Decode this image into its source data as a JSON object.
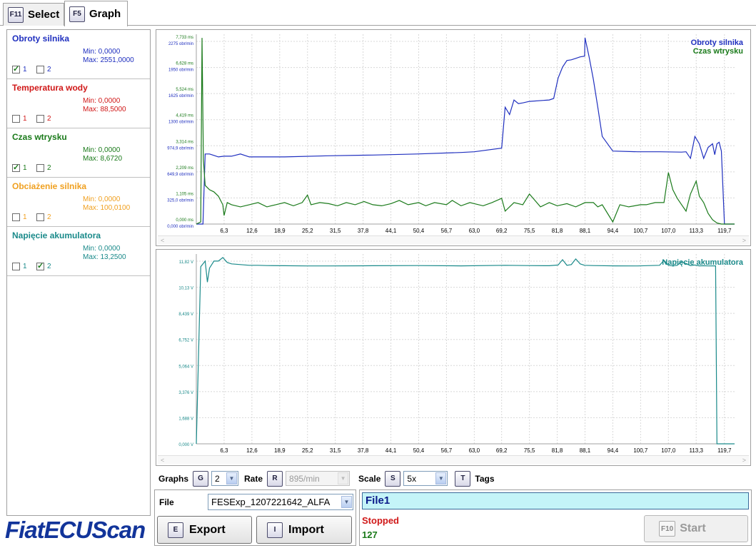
{
  "tabs": [
    {
      "key": "F11",
      "label": "Select"
    },
    {
      "key": "F5",
      "label": "Graph"
    }
  ],
  "signals": [
    {
      "name": "Obroty silnika",
      "min": "Min: 0,0000",
      "max": "Max: 2551,0000",
      "color": "#1f2fbf",
      "chk1": "1",
      "chk2": "2",
      "chk1_on": true,
      "chk2_on": false
    },
    {
      "name": "Temperatura wody",
      "min": "Min: 0,0000",
      "max": "Max: 88,5000",
      "color": "#d01818",
      "chk1": "1",
      "chk2": "2",
      "chk1_on": false,
      "chk2_on": false
    },
    {
      "name": "Czas wtrysku",
      "min": "Min: 0,0000",
      "max": "Max: 8,6720",
      "color": "#1a7a1a",
      "chk1": "1",
      "chk2": "2",
      "chk1_on": true,
      "chk2_on": false
    },
    {
      "name": "Obciażenie silnika",
      "min": "Min: 0,0000",
      "max": "Max: 100,0100",
      "color": "#f0a020",
      "chk1": "1",
      "chk2": "2",
      "chk1_on": false,
      "chk2_on": false
    },
    {
      "name": "Napięcie akumulatora",
      "min": "Min: 0,0000",
      "max": "Max: 13,2500",
      "color": "#1a8a8a",
      "chk1": "1",
      "chk2": "2",
      "chk1_on": false,
      "chk2_on": true
    }
  ],
  "logo": "FiatECUScan",
  "x_ticks": [
    "6,3",
    "12,6",
    "18,9",
    "25,2",
    "31,5",
    "37,8",
    "44,1",
    "50,4",
    "56,7",
    "63,0",
    "69,2",
    "75,5",
    "81,8",
    "88,1",
    "94,4",
    "100,7",
    "107,0",
    "113,3",
    "119,7"
  ],
  "graph1": {
    "legend": [
      "Obroty silnika",
      "Czas wtrysku"
    ],
    "legend_colors": [
      "#1f2fbf",
      "#1a7a1a"
    ],
    "y_labels_green": [
      "0,000 ms",
      "1,105 ms",
      "2,209 ms",
      "3,314 ms",
      "4,419 ms",
      "5,524 ms",
      "6,628 ms",
      "7,733 ms"
    ],
    "y_labels_blue": [
      "0,000 obr/min",
      "325,0 obr/min",
      "649,9 obr/min",
      "974,9 obr/min",
      "1300 obr/min",
      "1625 obr/min",
      "1950 obr/min",
      "2275 obr/min"
    ]
  },
  "graph2": {
    "legend": [
      "Napięcie akumulatora"
    ],
    "legend_colors": [
      "#1a8a8a"
    ],
    "y_labels": [
      "0,000 V",
      "1,688 V",
      "3,376 V",
      "5,064 V",
      "6,752 V",
      "8,439 V",
      "10,13 V",
      "11,82 V"
    ]
  },
  "chart_data": [
    {
      "type": "line",
      "title": "",
      "xlabel": "",
      "x_tick_labels": [
        "6,3",
        "12,6",
        "18,9",
        "25,2",
        "31,5",
        "37,8",
        "44,1",
        "50,4",
        "56,7",
        "63,0",
        "69,2",
        "75,5",
        "81,8",
        "88,1",
        "94,4",
        "100,7",
        "107,0",
        "113,3",
        "119,7"
      ],
      "xlim": [
        0,
        122
      ],
      "grid": true,
      "legend_position": "top-right",
      "series": [
        {
          "name": "Obroty silnika",
          "color": "#1f2fbf",
          "unit": "obr/min",
          "x": [
            0,
            1.5,
            2.0,
            3,
            4,
            5,
            6.3,
            8,
            10,
            12,
            20,
            30,
            40,
            50,
            60,
            63,
            69.2,
            70,
            71,
            72,
            73,
            74,
            75.5,
            80,
            81,
            82,
            83,
            84,
            85,
            86,
            87,
            88,
            88.1,
            89,
            90,
            91,
            92,
            94.4,
            100,
            105,
            110,
            111,
            112,
            113,
            114,
            115,
            116,
            117,
            117.5,
            118,
            118.5,
            119,
            119.7,
            120,
            121,
            122
          ],
          "y": [
            0,
            0,
            960,
            960,
            940,
            920,
            930,
            930,
            960,
            920,
            920,
            935,
            945,
            960,
            980,
            990,
            1040,
            1600,
            1500,
            1700,
            1650,
            1660,
            1680,
            1700,
            1720,
            2000,
            2150,
            2240,
            2250,
            2270,
            2290,
            2300,
            2551,
            2300,
            1980,
            1600,
            1200,
            1000,
            990,
            990,
            985,
            990,
            900,
            1200,
            1100,
            900,
            1050,
            1100,
            950,
            1100,
            1120,
            1000,
            0,
            0,
            0,
            0
          ]
        },
        {
          "name": "Czas wtrysku",
          "color": "#1a7a1a",
          "unit": "ms",
          "x": [
            0,
            1,
            1.3,
            1.6,
            2,
            3,
            4,
            5,
            6,
            6.3,
            7,
            8,
            10,
            12,
            14,
            16,
            18,
            20,
            22,
            24,
            25.2,
            26,
            28,
            30,
            32,
            34,
            36,
            38,
            40,
            42,
            44.1,
            46,
            48,
            50.4,
            52,
            54,
            56.7,
            58,
            60,
            62,
            63,
            65,
            67,
            69.2,
            70,
            72,
            74,
            75.5,
            78,
            80,
            81.8,
            84,
            86,
            88.1,
            90,
            91,
            92,
            94.4,
            96,
            98,
            100.7,
            102,
            104,
            106,
            107,
            108,
            109,
            110,
            111,
            112,
            113.3,
            114,
            115,
            116,
            117,
            118,
            119,
            120,
            121,
            122
          ],
          "y": [
            0,
            0.1,
            8.67,
            3.0,
            1.8,
            1.6,
            1.5,
            1.3,
            0.9,
            0.4,
            1.0,
            0.9,
            0.8,
            0.9,
            1.0,
            0.8,
            0.9,
            1.0,
            0.85,
            1.0,
            1.35,
            0.9,
            1.0,
            0.95,
            0.85,
            1.0,
            0.9,
            1.05,
            0.9,
            0.85,
            0.95,
            1.1,
            0.9,
            1.0,
            0.85,
            1.0,
            0.9,
            1.1,
            0.85,
            1.0,
            0.95,
            0.85,
            1.0,
            1.2,
            0.6,
            1.0,
            0.9,
            1.4,
            0.8,
            1.0,
            0.85,
            0.95,
            0.8,
            1.0,
            1.0,
            0.8,
            0.9,
            0.1,
            0.9,
            0.8,
            0.9,
            0.9,
            1.0,
            1.0,
            2.4,
            1.6,
            1.2,
            0.9,
            0.6,
            1.4,
            2.0,
            1.3,
            1.0,
            0.5,
            0.2,
            0.05,
            0,
            0,
            0,
            0
          ]
        }
      ],
      "y_ranges": {
        "Obroty silnika": [
          0,
          2600
        ],
        "Czas wtrysku": [
          0,
          8.84
        ]
      }
    },
    {
      "type": "line",
      "title": "",
      "xlabel": "",
      "xlim": [
        0,
        122
      ],
      "ylim": [
        0,
        13.5
      ],
      "grid": true,
      "legend_position": "top-right",
      "series": [
        {
          "name": "Napięcie akumulatora",
          "color": "#1a8a8a",
          "unit": "V",
          "x": [
            0,
            1,
            2,
            2.5,
            3,
            4,
            5,
            6,
            7,
            8,
            10,
            12,
            14,
            16,
            20,
            25,
            30,
            40,
            50,
            60,
            70,
            75,
            80,
            82,
            83,
            84,
            85,
            86,
            87,
            88,
            90,
            95,
            100,
            105,
            106,
            107,
            108,
            109,
            110,
            112,
            113,
            114,
            115,
            116,
            117,
            117.7,
            118,
            118.5,
            122
          ],
          "y": [
            0,
            12.6,
            13.0,
            11.5,
            12.5,
            13.0,
            13.0,
            13.25,
            12.9,
            12.8,
            12.75,
            12.7,
            12.7,
            12.68,
            12.67,
            12.65,
            12.65,
            12.67,
            12.68,
            12.66,
            12.7,
            12.68,
            12.67,
            12.72,
            13.1,
            12.7,
            12.75,
            13.15,
            12.8,
            12.7,
            12.68,
            12.66,
            12.65,
            12.7,
            13.05,
            12.7,
            12.65,
            12.7,
            12.95,
            12.68,
            12.72,
            12.66,
            12.67,
            12.65,
            12.66,
            12.66,
            0,
            0,
            0
          ]
        }
      ]
    }
  ],
  "controls": {
    "graphs_label": "Graphs",
    "graphs_key": "G",
    "graphs_value": "2",
    "rate_label": "Rate",
    "rate_key": "R",
    "rate_value": "895/min",
    "scale_label": "Scale",
    "scale_key": "S",
    "scale_value": "5x",
    "tags_key": "T",
    "tags_label": "Tags"
  },
  "file": {
    "label": "File",
    "value": "FESExp_1207221642_ALFA",
    "export_key": "E",
    "export_label": "Export",
    "import_key": "I",
    "import_label": "Import"
  },
  "status": {
    "filename": "File1",
    "state": "Stopped",
    "count": "127",
    "start_key": "F10",
    "start_label": "Start"
  }
}
